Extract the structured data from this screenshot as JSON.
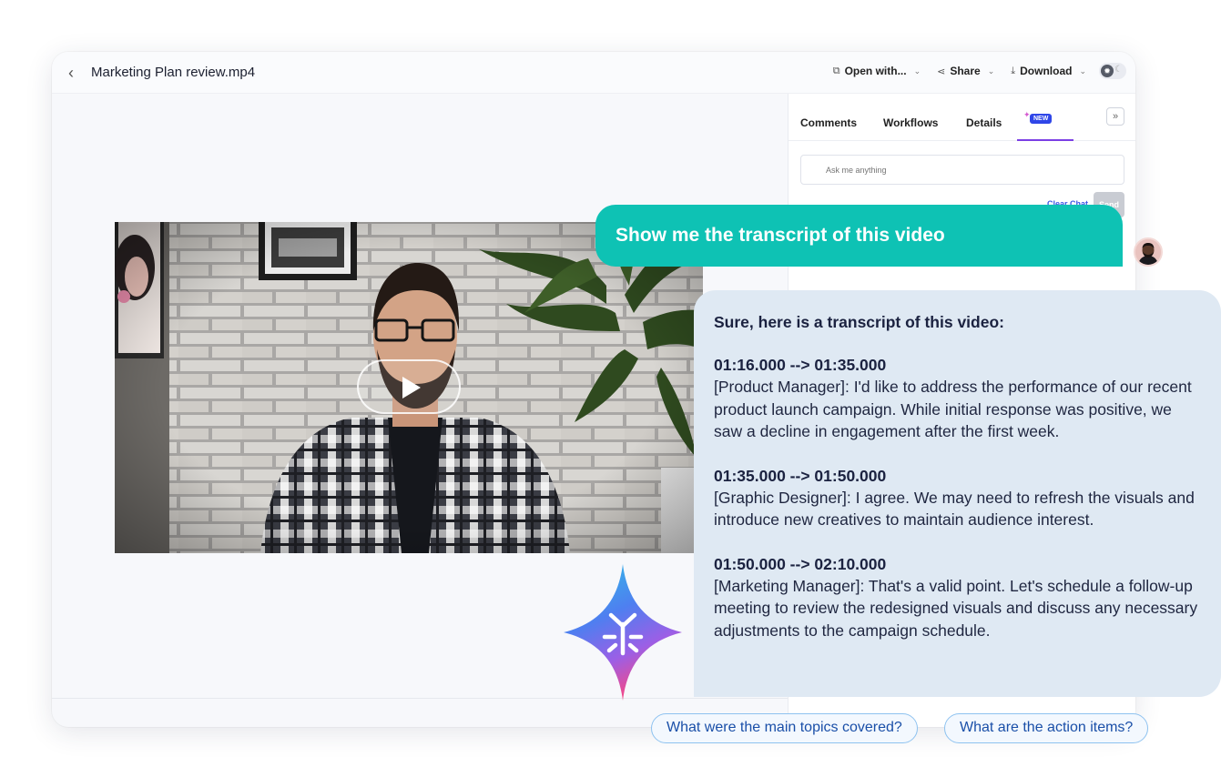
{
  "window": {
    "file_title": "Marketing Plan review.mp4",
    "actions": {
      "open_with": "Open with...",
      "share": "Share",
      "download": "Download"
    }
  },
  "side_panel": {
    "tabs": [
      "Comments",
      "Workflows",
      "Details"
    ],
    "ai_tab_badge": "NEW",
    "ask_placeholder": "Ask me anything",
    "clear_chat": "Clear Chat",
    "send": "Send"
  },
  "chat": {
    "user_message": "Show me the transcript of this video",
    "ai_intro": "Sure, here is a transcript of this video:",
    "transcript": [
      {
        "timestamp": "01:16.000 --> 01:35.000",
        "text": "[Product Manager]: I'd like to address the performance of our recent product launch campaign. While initial response was positive, we saw a decline in engagement after the first week."
      },
      {
        "timestamp": "01:35.000 --> 01:50.000",
        "text": "[Graphic Designer]: I agree. We may need to refresh the visuals and introduce new creatives to maintain audience interest."
      },
      {
        "timestamp": "01:50.000 --> 02:10.000",
        "text": "[Marketing Manager]: That's a valid point. Let's schedule a follow-up meeting to review the redesigned visuals and discuss any necessary adjustments to the campaign schedule."
      }
    ],
    "suggestions": [
      "What were the main topics covered?",
      "What are the action items?"
    ]
  },
  "colors": {
    "user_bubble": "#0ec2b4",
    "ai_bubble": "#dfe9f3",
    "accent": "#7b3fe4",
    "new_badge": "#2f46e8"
  }
}
